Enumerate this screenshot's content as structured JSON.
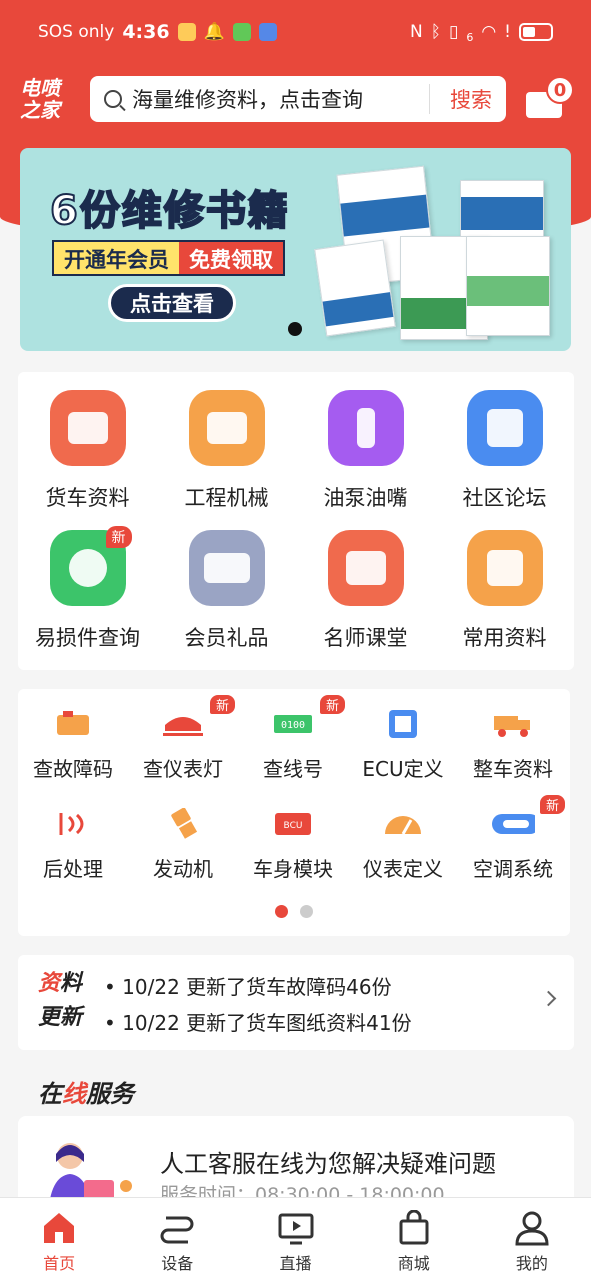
{
  "status_bar": {
    "carrier": "SOS only",
    "time": "4:36",
    "network_indicator": "6"
  },
  "header": {
    "logo_line1": "电喷",
    "logo_line2": "之家",
    "search_placeholder": "海量维修资料，点击查询",
    "search_button": "搜索",
    "message_count": "0"
  },
  "banner": {
    "title": "6份维修书籍",
    "pill_left": "开通年会员",
    "pill_right": "免费领取",
    "cta": "点击查看"
  },
  "main_menu": [
    {
      "label": "货车资料",
      "icon": "dump-truck-icon",
      "color": "#f06a4d"
    },
    {
      "label": "工程机械",
      "icon": "excavator-icon",
      "color": "#f5a24a"
    },
    {
      "label": "油泵油嘴",
      "icon": "injector-icon",
      "color": "#a55cf0"
    },
    {
      "label": "社区论坛",
      "icon": "books-icon",
      "color": "#4a8cf0"
    },
    {
      "label": "易损件查询",
      "icon": "parts-search-icon",
      "color": "#3cc46a",
      "badge": "新"
    },
    {
      "label": "会员礼品",
      "icon": "vip-card-icon",
      "color": "#9aa4c4"
    },
    {
      "label": "名师课堂",
      "icon": "video-play-icon",
      "color": "#f06a4d"
    },
    {
      "label": "常用资料",
      "icon": "star-box-icon",
      "color": "#f5a24a"
    }
  ],
  "tools_menu": [
    {
      "label": "查故障码",
      "icon": "engine-icon",
      "badge": ""
    },
    {
      "label": "查仪表灯",
      "icon": "dashboard-light-icon",
      "badge": "新"
    },
    {
      "label": "查线号",
      "icon": "wire-number-icon",
      "badge": "新"
    },
    {
      "label": "ECU定义",
      "icon": "ecu-chip-icon",
      "badge": ""
    },
    {
      "label": "整车资料",
      "icon": "truck-icon",
      "badge": ""
    },
    {
      "label": "后处理",
      "icon": "exhaust-icon",
      "badge": ""
    },
    {
      "label": "发动机",
      "icon": "piston-icon",
      "badge": ""
    },
    {
      "label": "车身模块",
      "icon": "bcu-module-icon",
      "badge": ""
    },
    {
      "label": "仪表定义",
      "icon": "gauge-icon",
      "badge": ""
    },
    {
      "label": "空调系统",
      "icon": "ac-panel-icon",
      "badge": "新"
    }
  ],
  "updates": {
    "tag_line1_a": "资",
    "tag_line1_b": "料",
    "tag_line2": "更新",
    "items": [
      "• 10/22 更新了货车故障码46份",
      "• 10/22 更新了货车图纸资料41份"
    ]
  },
  "online_service": {
    "section_a": "在",
    "section_b": "线",
    "section_c": "服务",
    "title": "人工客服在线为您解决疑难问题",
    "hours": "服务时间：08:30:00 - 18:00:00"
  },
  "tabbar": [
    {
      "label": "首页",
      "icon": "home-icon",
      "active": true
    },
    {
      "label": "设备",
      "icon": "device-route-icon",
      "active": false
    },
    {
      "label": "直播",
      "icon": "live-tv-icon",
      "active": false
    },
    {
      "label": "商城",
      "icon": "shopping-bag-icon",
      "active": false
    },
    {
      "label": "我的",
      "icon": "user-icon",
      "active": false
    }
  ],
  "colors": {
    "brand": "#e8483b",
    "background": "#f5f5f5"
  }
}
